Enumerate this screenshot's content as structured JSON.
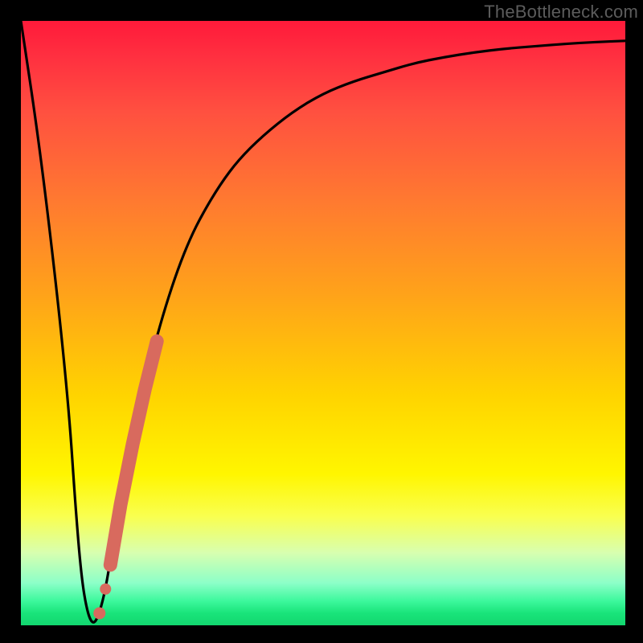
{
  "watermark": "TheBottleneck.com",
  "colors": {
    "frame": "#000000",
    "curve": "#000000",
    "marker": "#d86a5e",
    "gradient_top": "#ff1a3a",
    "gradient_bottom": "#12d66f"
  },
  "chart_data": {
    "type": "line",
    "title": "",
    "xlabel": "",
    "ylabel": "",
    "xlim": [
      0,
      100
    ],
    "ylim": [
      0,
      100
    ],
    "series": [
      {
        "name": "bottleneck-curve",
        "x": [
          0,
          3,
          6,
          8,
          9,
          10,
          11,
          12,
          13,
          14,
          15,
          16,
          18,
          20,
          22,
          24,
          26,
          28,
          30,
          33,
          36,
          40,
          45,
          50,
          55,
          60,
          65,
          70,
          75,
          80,
          85,
          90,
          95,
          100
        ],
        "values": [
          100,
          80,
          55,
          35,
          20,
          8,
          2,
          0,
          2,
          6,
          12,
          18,
          29,
          38,
          46,
          53,
          59,
          64,
          68,
          73,
          77,
          81,
          85,
          88,
          90,
          91.5,
          93,
          94,
          94.8,
          95.4,
          95.8,
          96.2,
          96.5,
          96.7
        ]
      }
    ],
    "markers": {
      "name": "highlight-segment",
      "points": [
        {
          "x": 13.0,
          "y": 2.0
        },
        {
          "x": 14.0,
          "y": 6.0
        },
        {
          "x": 14.8,
          "y": 10.0
        },
        {
          "x": 16.5,
          "y": 20.0
        },
        {
          "x": 18.5,
          "y": 30.0
        },
        {
          "x": 20.5,
          "y": 39.0
        },
        {
          "x": 22.5,
          "y": 47.0
        }
      ],
      "segment_thick": true
    }
  }
}
